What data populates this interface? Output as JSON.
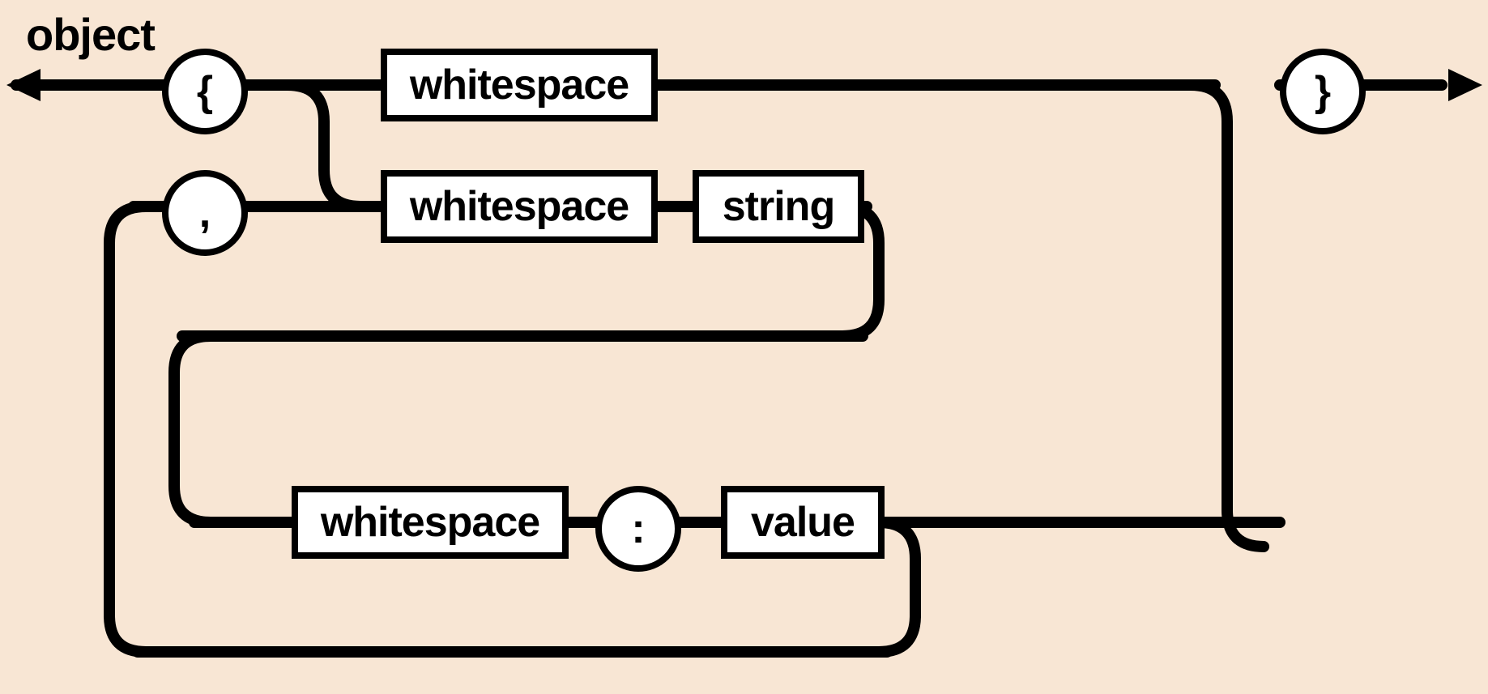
{
  "title": "object",
  "terminals": {
    "open_brace": "{",
    "close_brace": "}",
    "comma": ",",
    "colon": ":"
  },
  "nonterminals": {
    "whitespace1": "whitespace",
    "whitespace2": "whitespace",
    "whitespace3": "whitespace",
    "string": "string",
    "value": "value"
  },
  "colors": {
    "background": "#f8e6d4",
    "stroke": "#000000",
    "node_fill": "#ffffff"
  },
  "diagram_type": "railroad",
  "description": "JSON object grammar railroad diagram"
}
